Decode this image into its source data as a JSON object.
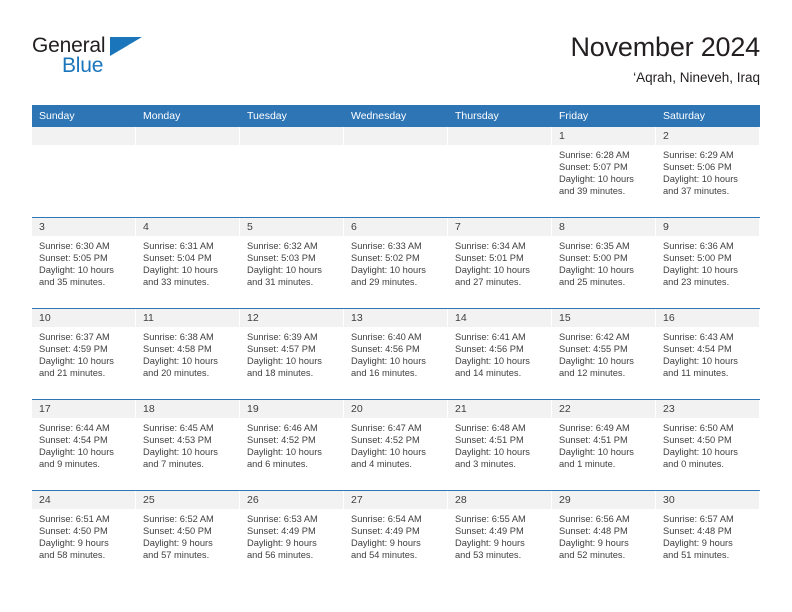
{
  "brand": {
    "name_part1": "General",
    "name_part2": "Blue",
    "triangle_icon": "triangle-icon",
    "colors": {
      "text": "#231f20",
      "accent": "#1b75bb"
    }
  },
  "header": {
    "title": "November 2024",
    "location": "‘Aqrah, Nineveh, Iraq"
  },
  "theme": {
    "header_blue": "#2e75b6",
    "date_band_gray": "#f2f2f2",
    "text_gray": "#404040"
  },
  "calendar": {
    "weekday_headers": [
      "Sunday",
      "Monday",
      "Tuesday",
      "Wednesday",
      "Thursday",
      "Friday",
      "Saturday"
    ],
    "weeks": [
      [
        {
          "blank": true
        },
        {
          "blank": true
        },
        {
          "blank": true
        },
        {
          "blank": true
        },
        {
          "blank": true
        },
        {
          "date": "1",
          "sunrise": "Sunrise: 6:28 AM",
          "sunset": "Sunset: 5:07 PM",
          "daylight1": "Daylight: 10 hours",
          "daylight2": "and 39 minutes."
        },
        {
          "date": "2",
          "sunrise": "Sunrise: 6:29 AM",
          "sunset": "Sunset: 5:06 PM",
          "daylight1": "Daylight: 10 hours",
          "daylight2": "and 37 minutes."
        }
      ],
      [
        {
          "date": "3",
          "sunrise": "Sunrise: 6:30 AM",
          "sunset": "Sunset: 5:05 PM",
          "daylight1": "Daylight: 10 hours",
          "daylight2": "and 35 minutes."
        },
        {
          "date": "4",
          "sunrise": "Sunrise: 6:31 AM",
          "sunset": "Sunset: 5:04 PM",
          "daylight1": "Daylight: 10 hours",
          "daylight2": "and 33 minutes."
        },
        {
          "date": "5",
          "sunrise": "Sunrise: 6:32 AM",
          "sunset": "Sunset: 5:03 PM",
          "daylight1": "Daylight: 10 hours",
          "daylight2": "and 31 minutes."
        },
        {
          "date": "6",
          "sunrise": "Sunrise: 6:33 AM",
          "sunset": "Sunset: 5:02 PM",
          "daylight1": "Daylight: 10 hours",
          "daylight2": "and 29 minutes."
        },
        {
          "date": "7",
          "sunrise": "Sunrise: 6:34 AM",
          "sunset": "Sunset: 5:01 PM",
          "daylight1": "Daylight: 10 hours",
          "daylight2": "and 27 minutes."
        },
        {
          "date": "8",
          "sunrise": "Sunrise: 6:35 AM",
          "sunset": "Sunset: 5:00 PM",
          "daylight1": "Daylight: 10 hours",
          "daylight2": "and 25 minutes."
        },
        {
          "date": "9",
          "sunrise": "Sunrise: 6:36 AM",
          "sunset": "Sunset: 5:00 PM",
          "daylight1": "Daylight: 10 hours",
          "daylight2": "and 23 minutes."
        }
      ],
      [
        {
          "date": "10",
          "sunrise": "Sunrise: 6:37 AM",
          "sunset": "Sunset: 4:59 PM",
          "daylight1": "Daylight: 10 hours",
          "daylight2": "and 21 minutes."
        },
        {
          "date": "11",
          "sunrise": "Sunrise: 6:38 AM",
          "sunset": "Sunset: 4:58 PM",
          "daylight1": "Daylight: 10 hours",
          "daylight2": "and 20 minutes."
        },
        {
          "date": "12",
          "sunrise": "Sunrise: 6:39 AM",
          "sunset": "Sunset: 4:57 PM",
          "daylight1": "Daylight: 10 hours",
          "daylight2": "and 18 minutes."
        },
        {
          "date": "13",
          "sunrise": "Sunrise: 6:40 AM",
          "sunset": "Sunset: 4:56 PM",
          "daylight1": "Daylight: 10 hours",
          "daylight2": "and 16 minutes."
        },
        {
          "date": "14",
          "sunrise": "Sunrise: 6:41 AM",
          "sunset": "Sunset: 4:56 PM",
          "daylight1": "Daylight: 10 hours",
          "daylight2": "and 14 minutes."
        },
        {
          "date": "15",
          "sunrise": "Sunrise: 6:42 AM",
          "sunset": "Sunset: 4:55 PM",
          "daylight1": "Daylight: 10 hours",
          "daylight2": "and 12 minutes."
        },
        {
          "date": "16",
          "sunrise": "Sunrise: 6:43 AM",
          "sunset": "Sunset: 4:54 PM",
          "daylight1": "Daylight: 10 hours",
          "daylight2": "and 11 minutes."
        }
      ],
      [
        {
          "date": "17",
          "sunrise": "Sunrise: 6:44 AM",
          "sunset": "Sunset: 4:54 PM",
          "daylight1": "Daylight: 10 hours",
          "daylight2": "and 9 minutes."
        },
        {
          "date": "18",
          "sunrise": "Sunrise: 6:45 AM",
          "sunset": "Sunset: 4:53 PM",
          "daylight1": "Daylight: 10 hours",
          "daylight2": "and 7 minutes."
        },
        {
          "date": "19",
          "sunrise": "Sunrise: 6:46 AM",
          "sunset": "Sunset: 4:52 PM",
          "daylight1": "Daylight: 10 hours",
          "daylight2": "and 6 minutes."
        },
        {
          "date": "20",
          "sunrise": "Sunrise: 6:47 AM",
          "sunset": "Sunset: 4:52 PM",
          "daylight1": "Daylight: 10 hours",
          "daylight2": "and 4 minutes."
        },
        {
          "date": "21",
          "sunrise": "Sunrise: 6:48 AM",
          "sunset": "Sunset: 4:51 PM",
          "daylight1": "Daylight: 10 hours",
          "daylight2": "and 3 minutes."
        },
        {
          "date": "22",
          "sunrise": "Sunrise: 6:49 AM",
          "sunset": "Sunset: 4:51 PM",
          "daylight1": "Daylight: 10 hours",
          "daylight2": "and 1 minute."
        },
        {
          "date": "23",
          "sunrise": "Sunrise: 6:50 AM",
          "sunset": "Sunset: 4:50 PM",
          "daylight1": "Daylight: 10 hours",
          "daylight2": "and 0 minutes."
        }
      ],
      [
        {
          "date": "24",
          "sunrise": "Sunrise: 6:51 AM",
          "sunset": "Sunset: 4:50 PM",
          "daylight1": "Daylight: 9 hours",
          "daylight2": "and 58 minutes."
        },
        {
          "date": "25",
          "sunrise": "Sunrise: 6:52 AM",
          "sunset": "Sunset: 4:50 PM",
          "daylight1": "Daylight: 9 hours",
          "daylight2": "and 57 minutes."
        },
        {
          "date": "26",
          "sunrise": "Sunrise: 6:53 AM",
          "sunset": "Sunset: 4:49 PM",
          "daylight1": "Daylight: 9 hours",
          "daylight2": "and 56 minutes."
        },
        {
          "date": "27",
          "sunrise": "Sunrise: 6:54 AM",
          "sunset": "Sunset: 4:49 PM",
          "daylight1": "Daylight: 9 hours",
          "daylight2": "and 54 minutes."
        },
        {
          "date": "28",
          "sunrise": "Sunrise: 6:55 AM",
          "sunset": "Sunset: 4:49 PM",
          "daylight1": "Daylight: 9 hours",
          "daylight2": "and 53 minutes."
        },
        {
          "date": "29",
          "sunrise": "Sunrise: 6:56 AM",
          "sunset": "Sunset: 4:48 PM",
          "daylight1": "Daylight: 9 hours",
          "daylight2": "and 52 minutes."
        },
        {
          "date": "30",
          "sunrise": "Sunrise: 6:57 AM",
          "sunset": "Sunset: 4:48 PM",
          "daylight1": "Daylight: 9 hours",
          "daylight2": "and 51 minutes."
        }
      ]
    ]
  }
}
